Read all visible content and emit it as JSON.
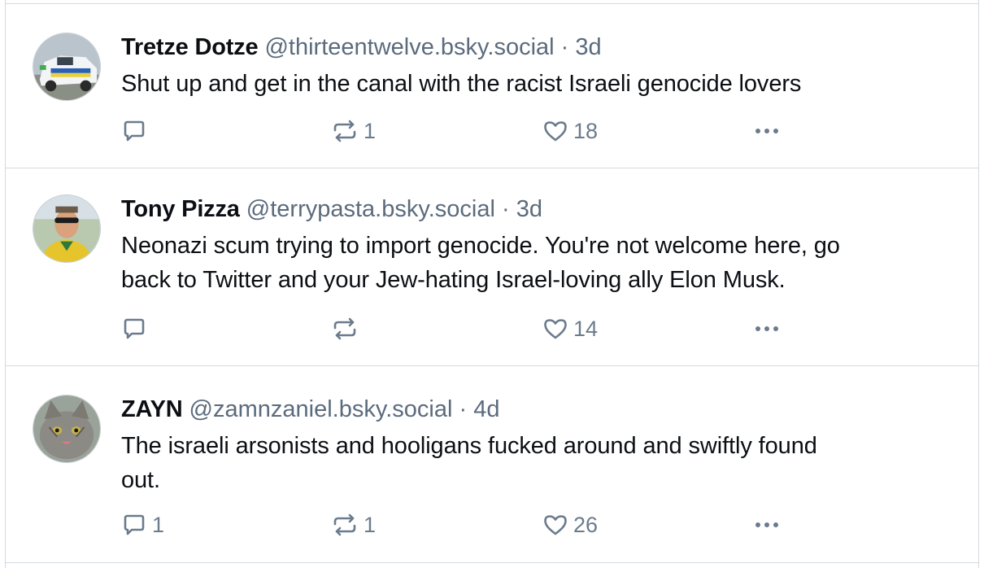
{
  "posts": [
    {
      "author_name": "Tretze Dotze",
      "handle": "@thirteentwelve.bsky.social",
      "separator": "·",
      "time": "3d",
      "text_lines": [
        "Shut up and get in the canal with the racist Israeli genocide lovers"
      ],
      "reply_count": "",
      "repost_count": "1",
      "like_count": "18",
      "avatar_icon": "police-car-avatar"
    },
    {
      "author_name": "Tony Pizza",
      "handle": "@terrypasta.bsky.social",
      "separator": "·",
      "time": "3d",
      "text_lines": [
        "Neonazi scum trying to import genocide. You're not welcome here, go",
        "back to Twitter and your Jew-hating Israel-loving ally Elon Musk."
      ],
      "reply_count": "",
      "repost_count": "",
      "like_count": "14",
      "avatar_icon": "man-sunglasses-avatar"
    },
    {
      "author_name": "ZAYN",
      "handle": "@zamnzaniel.bsky.social",
      "separator": "·",
      "time": "4d",
      "text_lines": [
        "The israeli arsonists and hooligans fucked around and swiftly found",
        "out."
      ],
      "reply_count": "1",
      "repost_count": "1",
      "like_count": "26",
      "avatar_icon": "cat-avatar"
    }
  ],
  "icons": {
    "reply": "reply-bubble-icon",
    "repost": "repost-arrows-icon",
    "like": "heart-icon",
    "more": "more-dots-icon"
  },
  "colors": {
    "border": "#d4dbe2",
    "meta_text": "#5b6b7d",
    "icon": "#6b7b8d"
  }
}
